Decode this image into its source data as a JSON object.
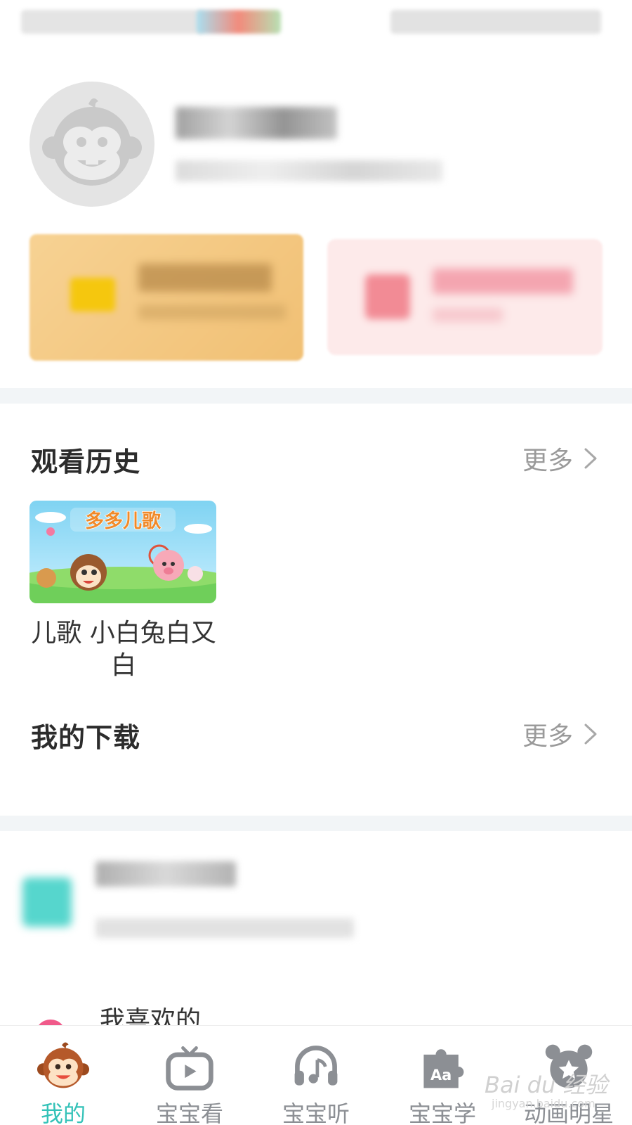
{
  "history": {
    "title": "观看历史",
    "more_label": "更多",
    "item": {
      "thumb_brand": "多多儿歌",
      "title": "儿歌  小白兔白又白"
    }
  },
  "downloads": {
    "title": "我的下载",
    "more_label": "更多"
  },
  "list_partial_label": "我喜欢的",
  "tabs": [
    {
      "label": "我的",
      "icon": "monkey-face-icon",
      "active": true
    },
    {
      "label": "宝宝看",
      "icon": "play-tv-icon",
      "active": false
    },
    {
      "label": "宝宝听",
      "icon": "headphones-icon",
      "active": false
    },
    {
      "label": "宝宝学",
      "icon": "puzzle-aa-icon",
      "active": false
    },
    {
      "label": "动画明星",
      "icon": "bear-star-icon",
      "active": false
    }
  ],
  "colors": {
    "accent": "#33c2b8",
    "tab_inactive": "#8c8f94",
    "vip_card": "#f4c77f",
    "pink_card": "#fdeaea"
  },
  "watermark": {
    "brand": "Bai du 经验",
    "url": "jingyan.baidu.com"
  }
}
